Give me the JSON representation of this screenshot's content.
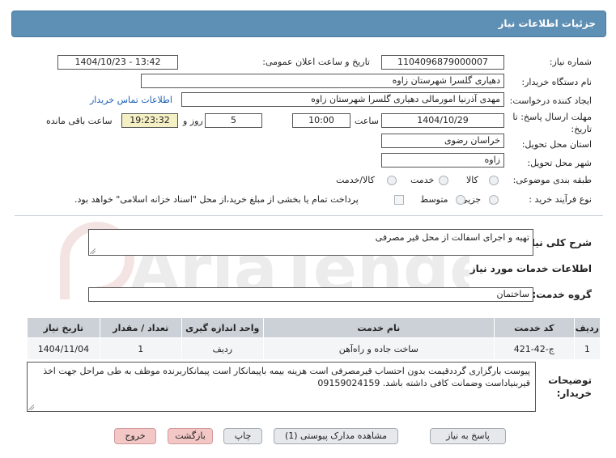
{
  "header": {
    "title": "جزئیات اطلاعات نیاز"
  },
  "form": {
    "need_number_label": "شماره نیاز:",
    "need_number": "1104096879000007",
    "announce_label": "تاریخ و ساعت اعلان عمومی:",
    "announce_value": "1404/10/23 - 13:42",
    "buyer_org_label": "نام دستگاه خریدار:",
    "buyer_org": "دهیاری گلسرا شهرستان زاوه",
    "creator_label": "ایجاد کننده درخواست:",
    "creator": "مهدی آذرنیا امورمالی دهیاری گلسرا شهرستان زاوه",
    "contact_link": "اطلاعات تماس خریدار",
    "deadline_label": "مهلت ارسال پاسخ: تا تاریخ:",
    "deadline_date": "1404/10/29",
    "time_label": "ساعت",
    "deadline_time": "10:00",
    "days": "5",
    "days_label": "روز و",
    "remaining_time": "19:23:32",
    "remaining_label": "ساعت باقی مانده",
    "province_label": "استان محل تحویل:",
    "province": "خراسان رضوی",
    "city_label": "شهر محل تحویل:",
    "city": "زاوه",
    "category_label": "طبقه بندی موضوعی:",
    "category_options": [
      "کالا",
      "خدمت",
      "کالا/خدمت"
    ],
    "purchase_type_label": "نوع فرآیند خرید :",
    "purchase_options": [
      "جزیی",
      "متوسط"
    ],
    "payment_note": "پرداخت تمام یا بخشی از مبلغ خرید،از محل \"اسناد خزانه اسلامی\" خواهد بود."
  },
  "summary": {
    "label": "شرح کلی نیاز:",
    "value": "تهیه و اجرای اسفالت از محل قیر مصرفی"
  },
  "services": {
    "section_title": "اطلاعات خدمات مورد نیاز",
    "group_label": "گروه خدمت:",
    "group_value": "ساختمان",
    "columns": [
      "ردیف",
      "کد خدمت",
      "نام خدمت",
      "واحد اندازه گیری",
      "تعداد / مقدار",
      "تاریخ نیاز"
    ],
    "rows": [
      [
        "1",
        "ج-42-421",
        "ساخت جاده و راه‌آهن",
        "ردیف",
        "1",
        "1404/11/04"
      ]
    ]
  },
  "notes": {
    "label": "توضیحات خریدار:",
    "value": "پیوست بارگزاری گرددقیمت بدون احتساب قیرمصرفی است هزینه بیمه باپیمانکار است پیمانکاربرنده موظف به طی مراحل جهت اخذ قیربنیاداست وضمانت کافی داشته باشد. 09159024159"
  },
  "buttons": {
    "reply": "پاسخ به نیاز",
    "view_docs": "مشاهده مدارک پیوستی (1)",
    "print": "چاپ",
    "back": "بازگشت",
    "exit": "خروج"
  },
  "watermark": {
    "text": "AriaTender.neT"
  }
}
